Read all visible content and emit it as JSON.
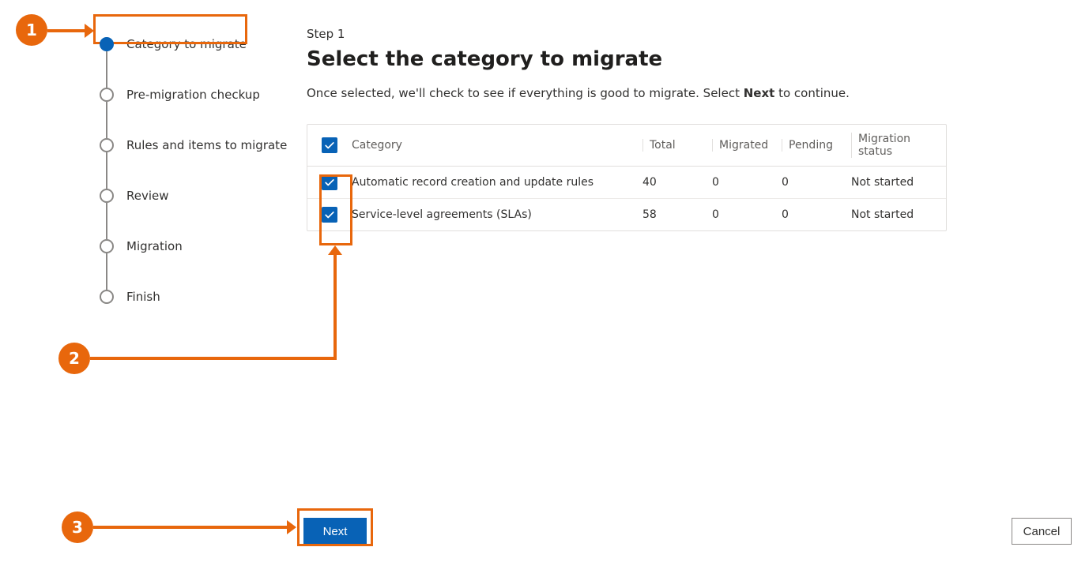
{
  "wizard": {
    "steps": [
      {
        "label": "Category to migrate",
        "active": true
      },
      {
        "label": "Pre-migration checkup",
        "active": false
      },
      {
        "label": "Rules and items to migrate",
        "active": false
      },
      {
        "label": "Review",
        "active": false
      },
      {
        "label": "Migration",
        "active": false
      },
      {
        "label": "Finish",
        "active": false
      }
    ]
  },
  "main": {
    "step_label": "Step 1",
    "title": "Select the category to migrate",
    "description_pre": "Once selected, we'll check to see if everything is good to migrate. Select ",
    "description_bold": "Next",
    "description_post": " to continue."
  },
  "table": {
    "headers": {
      "category": "Category",
      "total": "Total",
      "migrated": "Migrated",
      "pending": "Pending",
      "status": "Migration status"
    },
    "rows": [
      {
        "category": "Automatic record creation and update rules",
        "total": "40",
        "migrated": "0",
        "pending": "0",
        "status": "Not started"
      },
      {
        "category": "Service-level agreements (SLAs)",
        "total": "58",
        "migrated": "0",
        "pending": "0",
        "status": "Not started"
      }
    ]
  },
  "buttons": {
    "next": "Next",
    "cancel": "Cancel"
  },
  "annotations": {
    "n1": "1",
    "n2": "2",
    "n3": "3"
  }
}
